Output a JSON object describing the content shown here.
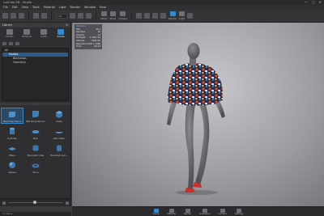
{
  "app": {
    "title": "LuxCreo 3D - Studio",
    "menus": [
      "File",
      "Edit",
      "View",
      "Tools",
      "Material",
      "Light",
      "Render",
      "Window",
      "Help"
    ],
    "window_controls": [
      "—",
      "▢",
      "✕"
    ]
  },
  "toolbar": {
    "zoom_value": "100",
    "labeled_buttons": [
      {
        "label": "Select",
        "active": false
      },
      {
        "label": "Move",
        "active": false
      },
      {
        "label": "Camera",
        "active": false
      },
      {
        "label": "Render",
        "active": true
      },
      {
        "label": "Light",
        "active": false
      }
    ]
  },
  "library": {
    "title": "Library",
    "tabs": [
      {
        "label": "Models",
        "active": false
      },
      {
        "label": "Materials",
        "active": false
      },
      {
        "label": "Lights",
        "active": false
      },
      {
        "label": "Scenes",
        "active": true
      }
    ],
    "tree": [
      {
        "label": "All",
        "level": 0,
        "selected": false
      },
      {
        "label": "Models",
        "level": 1,
        "selected": true
      },
      {
        "label": "Backdrops",
        "level": 2,
        "selected": false
      },
      {
        "label": "Geometry",
        "level": 2,
        "selected": false
      }
    ],
    "assets": [
      {
        "label": "Backdrop Plane",
        "shape": "plane-backdrop",
        "selected": true
      },
      {
        "label": "Backdrop Round",
        "shape": "round-backdrop",
        "selected": false
      },
      {
        "label": "Cube",
        "shape": "cube",
        "selected": false
      },
      {
        "label": "Cylinder",
        "shape": "cylinder",
        "selected": false
      },
      {
        "label": "Disc",
        "shape": "disc",
        "selected": false
      },
      {
        "label": "Disc Open",
        "shape": "disc-open",
        "selected": false
      },
      {
        "label": "Plane",
        "shape": "plane",
        "selected": false
      },
      {
        "label": "Rounded Cube",
        "shape": "rounded-cube",
        "selected": false
      },
      {
        "label": "Rounded Cyli...",
        "shape": "rounded-cylinder",
        "selected": false
      },
      {
        "label": "Sphere",
        "shape": "sphere",
        "selected": false
      },
      {
        "label": "Torus",
        "shape": "torus",
        "selected": false
      }
    ],
    "status": "11 items"
  },
  "viewport": {
    "stats": {
      "header": "Statistics",
      "rows": [
        {
          "k": "FPS",
          "v": "30.1"
        },
        {
          "k": "Samples",
          "v": "64"
        },
        {
          "k": "Objects",
          "v": "12"
        },
        {
          "k": "Triangles",
          "v": "1,286,734"
        },
        {
          "k": "Vertices",
          "v": "648,220"
        },
        {
          "k": "Resolution",
          "v": "1920 x 1080"
        },
        {
          "k": "Time",
          "v": "00:12"
        }
      ]
    }
  },
  "bottombar": {
    "buttons": [
      {
        "label": "Scene",
        "active": true
      },
      {
        "label": "Material",
        "active": false
      },
      {
        "label": "Render",
        "active": false
      },
      {
        "label": "Animation",
        "active": false
      },
      {
        "label": "Camera",
        "active": false
      },
      {
        "label": "Settings",
        "active": false
      }
    ]
  },
  "colors": {
    "accent": "#2e8bd4",
    "panel": "#2f2f31",
    "selection": "#2b5d8c"
  }
}
